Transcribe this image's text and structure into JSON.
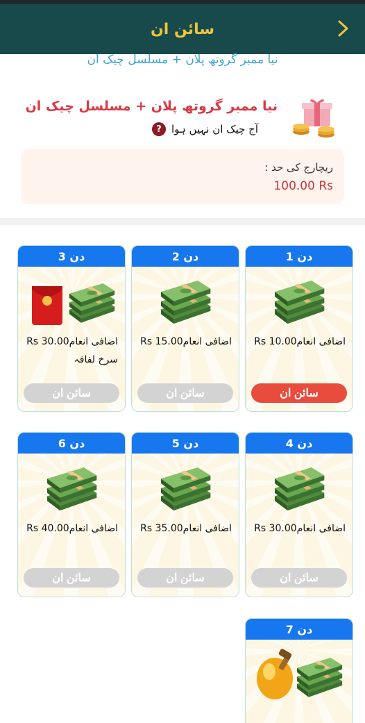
{
  "header": {
    "title": "سائن ان"
  },
  "subtitle": "نیا ممبر گروتھ پلان + مسلسل چیک ان",
  "promo": {
    "title": "نیا ممبر گروتھ پلان + مسلسل چیک ان",
    "status": "آج چیک ان نہیں ہوا",
    "help_glyph": "?"
  },
  "recharge_limit": {
    "label": "ریچارج کی حد :",
    "value": "100.00 Rs"
  },
  "days": [
    {
      "label": "دن 1",
      "reward_label": "اضافی انعام",
      "reward_amount": "10.00 Rs",
      "extra": "",
      "button": "سائن ان",
      "active": true,
      "image": "cash-stack-icon"
    },
    {
      "label": "دن 2",
      "reward_label": "اضافی انعام",
      "reward_amount": "15.00 Rs",
      "extra": "",
      "button": "سائن ان",
      "active": false,
      "image": "cash-stack-icon"
    },
    {
      "label": "دن 3",
      "reward_label": "اضافی انعام",
      "reward_amount": "30.00 Rs",
      "extra": "سرخ لفافہ",
      "button": "سائن ان",
      "active": false,
      "image": "red-envelope-and-cash-icon"
    },
    {
      "label": "دن 4",
      "reward_label": "اضافی انعام",
      "reward_amount": "30.00 Rs",
      "extra": "",
      "button": "سائن ان",
      "active": false,
      "image": "cash-stack-icon"
    },
    {
      "label": "دن 5",
      "reward_label": "اضافی انعام",
      "reward_amount": "35.00 Rs",
      "extra": "",
      "button": "سائن ان",
      "active": false,
      "image": "cash-stack-icon"
    },
    {
      "label": "دن 6",
      "reward_label": "اضافی انعام",
      "reward_amount": "40.00 Rs",
      "extra": "",
      "button": "سائن ان",
      "active": false,
      "image": "cash-stack-icon"
    },
    {
      "label": "دن 7",
      "reward_label": "",
      "reward_amount": "",
      "extra": "",
      "button": "",
      "active": false,
      "image": "gold-egg-and-cash-icon"
    }
  ],
  "colors": {
    "header_bg": "#184a4c",
    "header_title": "#f0c43a",
    "day_header": "#1677ee",
    "active_button": "#e84c3d",
    "disabled_button": "#d3d3d3",
    "promo_title": "#d83a46"
  }
}
